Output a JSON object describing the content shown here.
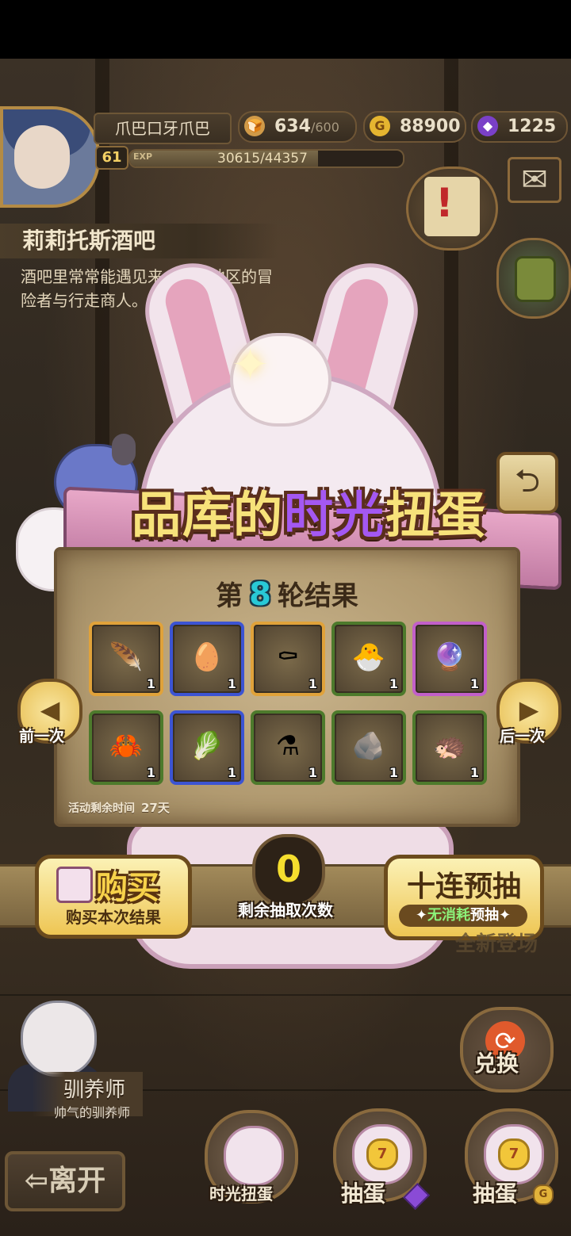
{
  "player": {
    "name": "爪巴口牙爪巴",
    "level": "61",
    "exp_tag": "EXP",
    "exp_text": "30615/44357",
    "exp_fraction": 0.69
  },
  "resources": {
    "stamina_value": "634",
    "stamina_max": "/600",
    "gold_value": "88900",
    "gold_icon": "G",
    "gem_value": "1225"
  },
  "location": {
    "title": "莉莉托斯酒吧",
    "desc_line1": "酒吧里常常能遇见来",
    "desc_line1_b": "地区的冒",
    "desc_line2": "险者与行走商人。"
  },
  "banner": {
    "title_part1": "品库的",
    "title_highlight": "时光",
    "title_part2": "扭蛋"
  },
  "results": {
    "round_prefix": "第",
    "round_number": "8",
    "round_suffix": "轮结果",
    "time_left_label": "活动剩余时间",
    "time_left_value": "27天",
    "items": [
      {
        "icon": "feather-bundle-icon",
        "glyph": "🪶",
        "qty": "1",
        "rarity": "gold"
      },
      {
        "icon": "green-egg-icon",
        "glyph": "🥚",
        "qty": "1",
        "rarity": "blue"
      },
      {
        "icon": "coffin-icon",
        "glyph": "⚰",
        "qty": "1",
        "rarity": "gold"
      },
      {
        "icon": "cracked-egg-nest-icon",
        "glyph": "🐣",
        "qty": "1",
        "rarity": "green"
      },
      {
        "icon": "crystal-egg-icon",
        "glyph": "🔮",
        "qty": "1",
        "rarity": "purple"
      },
      {
        "icon": "crab-icon",
        "glyph": "🦀",
        "qty": "1",
        "rarity": "green"
      },
      {
        "icon": "cactus-cabbage-icon",
        "glyph": "🥬",
        "qty": "1",
        "rarity": "blue"
      },
      {
        "icon": "potion-flask-icon",
        "glyph": "⚗",
        "qty": "1",
        "rarity": "green"
      },
      {
        "icon": "stone-egg-icon",
        "glyph": "🪨",
        "qty": "1",
        "rarity": "green"
      },
      {
        "icon": "hair-wig-icon",
        "glyph": "🦔",
        "qty": "1",
        "rarity": "green"
      }
    ]
  },
  "nav": {
    "prev_label": "前一次",
    "next_label": "后一次"
  },
  "actions": {
    "buy_big": "购买",
    "buy_small": "购买本次结果",
    "draw_count": "0",
    "draw_label": "剩余抽取次数",
    "ten_big": "十连预抽",
    "ten_small_green": "无消耗",
    "ten_small_rest": "预抽",
    "new_tag": "全新登场"
  },
  "trainer": {
    "name": "驯养师",
    "subtitle": "帅气的驯养师"
  },
  "bottom": {
    "leave": "离开",
    "time_gacha": "时光扭蛋",
    "draw_gem": "抽蛋",
    "draw_gold": "抽蛋",
    "exchange": "兑换",
    "gold_icon": "G"
  },
  "colors": {
    "round_number": "#29c9d6",
    "draw_count": "#f5de2e",
    "banner_highlight": "#a458f2"
  }
}
